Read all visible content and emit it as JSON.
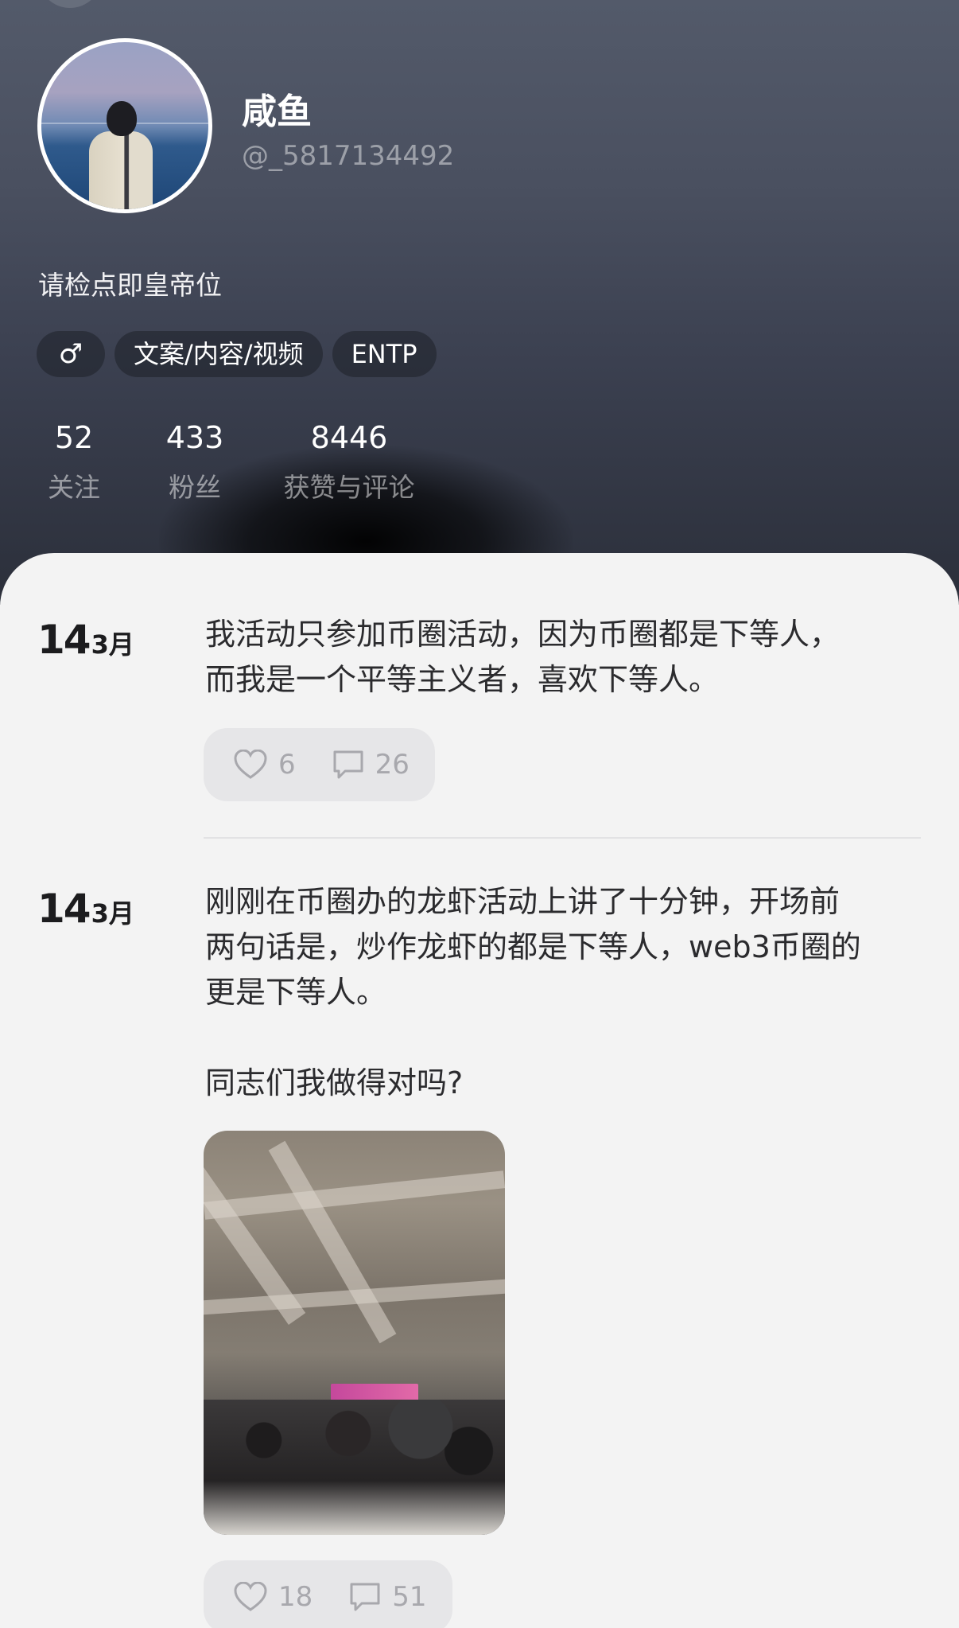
{
  "profile": {
    "name": "咸鱼",
    "handle": "@_5817134492",
    "bio": "请检点即皇帝位",
    "tags": [
      {
        "icon": "male-gender-icon",
        "glyph": "♂"
      },
      {
        "label": "文案/内容/视频"
      },
      {
        "label": "ENTP"
      }
    ],
    "stats": [
      {
        "value": "52",
        "label": "关注"
      },
      {
        "value": "433",
        "label": "粉丝"
      },
      {
        "value": "8446",
        "label": "获赞与评论"
      }
    ]
  },
  "posts": [
    {
      "day": "14",
      "month": "3月",
      "text": "我活动只参加币圈活动，因为币圈都是下等人，\n而我是一个平等主义者，喜欢下等人。",
      "likes": "6",
      "comments": "26"
    },
    {
      "day": "14",
      "month": "3月",
      "text": "刚刚在币圈办的龙虾活动上讲了十分钟，开场前\n两句话是，炒作龙虾的都是下等人，web3币圈的\n更是下等人。\n\n同志们我做得对吗?",
      "likes": "18",
      "comments": "51"
    }
  ]
}
